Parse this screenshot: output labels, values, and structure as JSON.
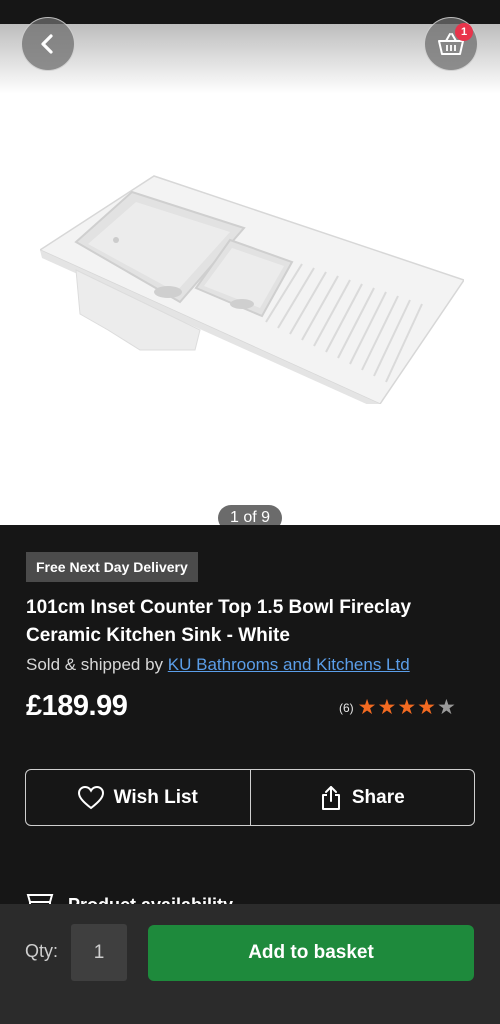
{
  "gallery": {
    "counter": "1 of 9",
    "basket_count": "1",
    "image_alt": "inset-ceramic-sink-photo"
  },
  "icons": {
    "back": "chevron-left-icon",
    "basket": "basket-icon",
    "wishlist": "heart-icon",
    "share": "share-icon",
    "availability": "store-icon",
    "star": "star-icon"
  },
  "product": {
    "badge": "Free Next Day Delivery",
    "title": "101cm Inset Counter Top 1.5 Bowl Fireclay Ceramic Kitchen Sink - White",
    "seller_prefix": "Sold & shipped by ",
    "seller_name": "KU Bathrooms and Kitchens Ltd",
    "price": "£189.99",
    "rating_count": "(6)",
    "rating_stars": 4,
    "rating_max": 5
  },
  "actions": {
    "wishlist_label": "Wish List",
    "share_label": "Share"
  },
  "availability": {
    "label": "Product availability"
  },
  "purchase": {
    "qty_label": "Qty:",
    "qty_value": "1",
    "add_label": "Add to basket"
  },
  "colors": {
    "star_filled": "#f26a21",
    "star_empty": "#9a9a9a",
    "add_button": "#1e8a3c",
    "link": "#5b9ee9",
    "badge": "#e8344b"
  }
}
